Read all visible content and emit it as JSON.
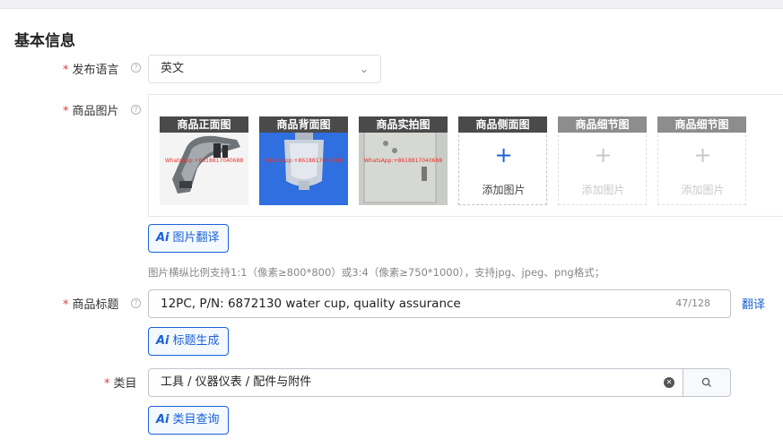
{
  "section": {
    "title": "基本信息"
  },
  "language": {
    "label": "发布语言",
    "required_mark": "*",
    "help_icon": "question-circle-icon",
    "value": "英文",
    "dropdown_icon": "chevron-down-icon"
  },
  "images": {
    "label": "商品图片",
    "required_mark": "*",
    "help_icon": "question-circle-icon",
    "slots": [
      {
        "caption": "商品正面图",
        "filled": true,
        "watermark": "WhatsApp:+8618817040688"
      },
      {
        "caption": "商品背面图",
        "filled": true,
        "watermark": "WhatsApp:+8618817040688"
      },
      {
        "caption": "商品实拍图",
        "filled": true,
        "watermark": "WhatsApp:+8618817040688"
      },
      {
        "caption": "商品侧面图",
        "filled": false,
        "plus": "+",
        "add_text": "添加图片"
      },
      {
        "caption": "商品细节图",
        "filled": false,
        "plus": "+",
        "add_text": "添加图片"
      },
      {
        "caption": "商品细节图",
        "filled": false,
        "plus": "+",
        "add_text": "添加图片"
      }
    ],
    "ai_button": {
      "ai_mark": "Ai",
      "label": "图片翻译"
    },
    "hint": "图片横纵比例支持1:1（像素≥800*800）或3:4（像素≥750*1000），支持jpg、jpeg、png格式；"
  },
  "title_field": {
    "label": "商品标题",
    "required_mark": "*",
    "help_icon": "question-circle-icon",
    "value": "12PC, P/N: 6872130 water cup, quality assurance",
    "count": "47/128",
    "translate": "翻译",
    "ai_button": {
      "ai_mark": "Ai",
      "label": "标题生成"
    }
  },
  "category": {
    "label": "类目",
    "required_mark": "*",
    "value": "工具 / 仪器仪表 / 配件与附件",
    "clear_icon": "clear-circle-icon",
    "search_icon": "search-icon",
    "ai_button": {
      "ai_mark": "Ai",
      "label": "类目查询"
    }
  },
  "colors": {
    "accent": "#1a62d6",
    "required": "#e4393c",
    "caption_dark": "#4a4a4a",
    "caption_disabled": "#8d8d8d"
  }
}
